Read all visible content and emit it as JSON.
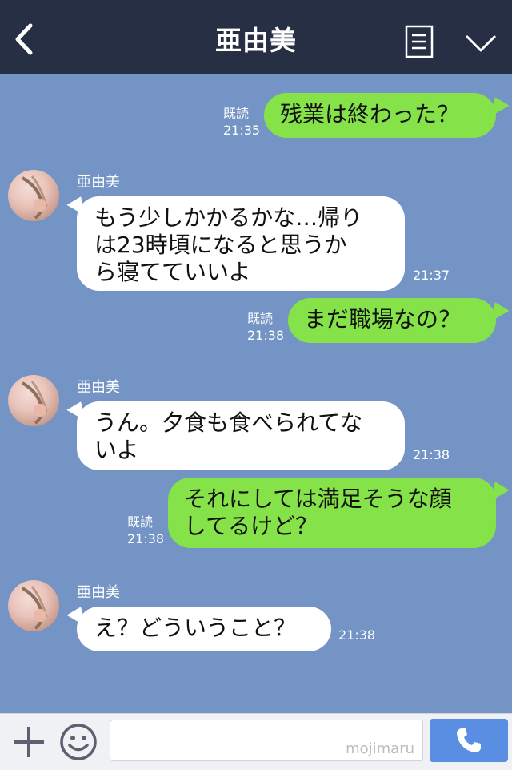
{
  "header": {
    "title": "亜由美"
  },
  "messages": [
    {
      "type": "sent",
      "text": "残業は終わった？",
      "read": "既読",
      "time": "21:35"
    },
    {
      "type": "received",
      "name": "亜由美",
      "lines": [
        "もう少しかかるかな…帰り",
        "は23時頃になると思うか",
        "ら寝てていいよ"
      ],
      "time": "21:37"
    },
    {
      "type": "sent",
      "text": "まだ職場なの？",
      "read": "既読",
      "time": "21:38"
    },
    {
      "type": "received",
      "name": "亜由美",
      "lines": [
        "うん。夕食も食べられてな",
        "いよ"
      ],
      "time": "21:38"
    },
    {
      "type": "sent",
      "lines": [
        "それにしては満足そうな顔",
        "してるけど？"
      ],
      "read": "既読",
      "time": "21:38"
    },
    {
      "type": "received",
      "name": "亜由美",
      "text": "え？どういうこと？",
      "time": "21:38"
    }
  ],
  "footer": {
    "watermark": "mojimaru"
  },
  "colors": {
    "header": "#262f44",
    "chat_bg": "#7394c4",
    "sent_bubble": "#85e249",
    "received_bubble": "#ffffff",
    "call_button": "#5a8ee3"
  },
  "icons": [
    "back-icon",
    "menu-icon",
    "chevron-down-icon",
    "plus-icon",
    "smile-icon",
    "phone-icon"
  ]
}
